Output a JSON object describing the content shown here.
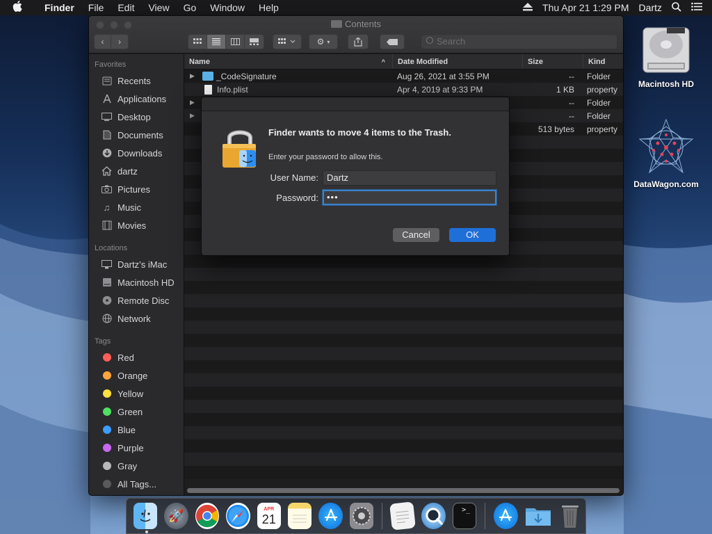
{
  "menubar": {
    "app_name": "Finder",
    "menus": [
      "File",
      "Edit",
      "View",
      "Go",
      "Window",
      "Help"
    ],
    "clock": "Thu Apr 21  1:29 PM",
    "user": "Dartz"
  },
  "window": {
    "title": "Contents",
    "search_placeholder": "Search"
  },
  "sidebar": {
    "favorites_header": "Favorites",
    "favorites": [
      {
        "label": "Recents",
        "icon": "clock-icon"
      },
      {
        "label": "Applications",
        "icon": "applications-icon"
      },
      {
        "label": "Desktop",
        "icon": "desktop-icon"
      },
      {
        "label": "Documents",
        "icon": "document-icon"
      },
      {
        "label": "Downloads",
        "icon": "download-icon"
      },
      {
        "label": "dartz",
        "icon": "home-icon"
      },
      {
        "label": "Pictures",
        "icon": "camera-icon"
      },
      {
        "label": "Music",
        "icon": "music-note-icon"
      },
      {
        "label": "Movies",
        "icon": "film-icon"
      }
    ],
    "locations_header": "Locations",
    "locations": [
      {
        "label": "Dartz’s iMac",
        "icon": "computer-icon"
      },
      {
        "label": "Macintosh HD",
        "icon": "disk-icon"
      },
      {
        "label": "Remote Disc",
        "icon": "disc-icon"
      },
      {
        "label": "Network",
        "icon": "globe-icon"
      }
    ],
    "tags_header": "Tags",
    "tags": [
      {
        "label": "Red",
        "color": "#ff5f57"
      },
      {
        "label": "Orange",
        "color": "#ffa53d"
      },
      {
        "label": "Yellow",
        "color": "#ffe23d"
      },
      {
        "label": "Green",
        "color": "#4ee063"
      },
      {
        "label": "Blue",
        "color": "#3c9cff"
      },
      {
        "label": "Purple",
        "color": "#c868f0"
      },
      {
        "label": "Gray",
        "color": "#b8b8ba"
      },
      {
        "label": "All Tags...",
        "color": "#5a5a5c"
      }
    ]
  },
  "columns": {
    "name": "Name",
    "date": "Date Modified",
    "size": "Size",
    "kind": "Kind"
  },
  "files": [
    {
      "name": "_CodeSignature",
      "date": "Aug 26, 2021 at 3:55 PM",
      "size": "--",
      "kind": "Folder",
      "type": "folder"
    },
    {
      "name": "Info.plist",
      "date": "Apr 4, 2019 at 9:33 PM",
      "size": "1 KB",
      "kind": "property",
      "type": "file"
    },
    {
      "name": "",
      "date": "",
      "size": "--",
      "kind": "Folder",
      "type": "folder-hidden"
    },
    {
      "name": "",
      "date": "",
      "size": "--",
      "kind": "Folder",
      "type": "folder-hidden"
    },
    {
      "name": "",
      "date": "",
      "size": "513 bytes",
      "kind": "property",
      "type": "file-hidden"
    }
  ],
  "dialog": {
    "title": "Finder wants to move 4 items to the Trash.",
    "subtitle": "Enter your password to allow this.",
    "username_label": "User Name:",
    "username_value": "Dartz",
    "password_label": "Password:",
    "password_value": "•••",
    "cancel_label": "Cancel",
    "ok_label": "OK"
  },
  "desktop": {
    "icons": [
      {
        "label": "Macintosh HD"
      },
      {
        "label": "DataWagon.com"
      }
    ]
  },
  "dock": {
    "apps": [
      "Finder",
      "Launchpad",
      "Chrome",
      "Safari",
      "Calendar",
      "Notes",
      "App Store",
      "System Preferences",
      "TextEdit",
      "QuickTime Player",
      "Terminal",
      "Applications",
      "Downloads",
      "Trash"
    ],
    "calendar_month": "APR",
    "calendar_day": "21"
  }
}
